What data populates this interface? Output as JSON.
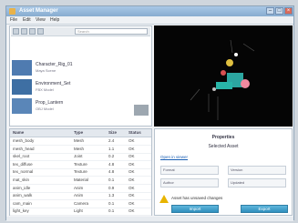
{
  "window": {
    "title": "Asset Manager"
  },
  "menu": [
    "File",
    "Edit",
    "View",
    "Help"
  ],
  "browser": {
    "search_placeholder": "Search",
    "assets": [
      {
        "name": "Character_Rig_01",
        "meta": "Maya Scene",
        "color": "#4f7bb0"
      },
      {
        "name": "Environment_Set",
        "meta": "FBX Model",
        "color": "#3e6fa3"
      },
      {
        "name": "Prop_Lantern",
        "meta": "OBJ Model",
        "color": "#5a86b8"
      }
    ]
  },
  "table": {
    "headers": [
      "Name",
      "Type",
      "Size",
      "Status"
    ],
    "rows": [
      [
        "mesh_body",
        "Mesh",
        "2.4",
        "OK"
      ],
      [
        "mesh_head",
        "Mesh",
        "1.1",
        "OK"
      ],
      [
        "skel_root",
        "Joint",
        "0.2",
        "OK"
      ],
      [
        "tex_diffuse",
        "Texture",
        "4.8",
        "OK"
      ],
      [
        "tex_normal",
        "Texture",
        "4.8",
        "OK"
      ],
      [
        "mat_skin",
        "Material",
        "0.1",
        "OK"
      ],
      [
        "anim_idle",
        "Anim",
        "0.9",
        "OK"
      ],
      [
        "anim_walk",
        "Anim",
        "1.3",
        "OK"
      ],
      [
        "cam_main",
        "Camera",
        "0.1",
        "OK"
      ],
      [
        "light_key",
        "Light",
        "0.1",
        "OK"
      ]
    ]
  },
  "properties": {
    "title": "Properties",
    "subtitle": "Selected Asset",
    "link": "Open in viewer",
    "fields": [
      "Format",
      "Version",
      "Author",
      "Updated"
    ],
    "warning": "Asset has unsaved changes",
    "buttons": [
      "Import",
      "Export"
    ]
  }
}
